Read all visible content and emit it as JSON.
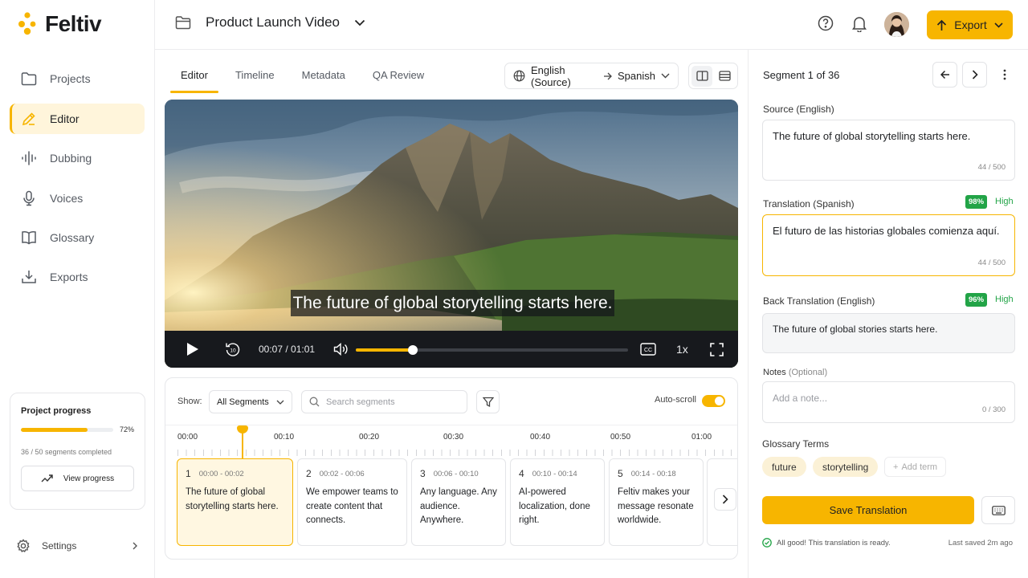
{
  "app": {
    "name": "Feltiv"
  },
  "sidebar": {
    "items": [
      {
        "label": "Projects",
        "icon": "folder-icon",
        "active": false
      },
      {
        "label": "Editor",
        "icon": "pencil-icon",
        "active": true
      },
      {
        "label": "Dubbing",
        "icon": "waveform-icon",
        "active": false
      },
      {
        "label": "Voices",
        "icon": "microphone-icon",
        "active": false
      },
      {
        "label": "Glossary",
        "icon": "book-icon",
        "active": false
      },
      {
        "label": "Exports",
        "icon": "download-tray-icon",
        "active": false
      }
    ],
    "progress": {
      "title": "Project progress",
      "percent_label": "72%",
      "percent": 72,
      "segments_text": "36 / 50 segments completed",
      "button": "View progress"
    },
    "settings_label": "Settings"
  },
  "header": {
    "project_title": "Product Launch Video",
    "export_label": "Export"
  },
  "tabs": [
    {
      "label": "Editor",
      "active": true
    },
    {
      "label": "Timeline",
      "active": false
    },
    {
      "label": "Metadata",
      "active": false
    },
    {
      "label": "QA Review",
      "active": false
    }
  ],
  "language": {
    "source": "English (Source)",
    "target": "Spanish"
  },
  "video": {
    "subtitle": "The future of global storytelling starts here.",
    "time": "00:07 / 01:01",
    "speed": "1x",
    "progress_fraction": 0.21
  },
  "segments_panel": {
    "show_label": "Show:",
    "filter_value": "All Segments",
    "search_placeholder": "Search segments",
    "autoscroll_label": "Auto-scroll",
    "autoscroll_on": true,
    "ruler": [
      "00:00",
      "00:10",
      "00:20",
      "00:30",
      "00:40",
      "00:50",
      "01:00"
    ],
    "cards": [
      {
        "num": "1",
        "time": "00:00 - 00:02",
        "text": "The future of global storytelling starts here.",
        "active": true
      },
      {
        "num": "2",
        "time": "00:02 - 00:06",
        "text": "We empower teams to create content that connects.",
        "active": false
      },
      {
        "num": "3",
        "time": "00:06 - 00:10",
        "text": "Any language. Any audience. Anywhere.",
        "active": false
      },
      {
        "num": "4",
        "time": "00:10 - 00:14",
        "text": "AI-powered localization, done right.",
        "active": false
      },
      {
        "num": "5",
        "time": "00:14 - 00:18",
        "text": "Feltiv makes your message resonate worldwide.",
        "active": false
      }
    ]
  },
  "right_panel": {
    "segment_label": "Segment 1 of 36",
    "source": {
      "label": "Source (English)",
      "text": "The future of global storytelling starts here.",
      "count": "44 / 500"
    },
    "translation": {
      "label": "Translation (Spanish)",
      "text": "El futuro de las historias globales comienza aquí.",
      "count": "44 / 500",
      "score": "98%",
      "quality": "High"
    },
    "back_translation": {
      "label": "Back Translation (English)",
      "text": "The future of global stories starts here.",
      "score": "96%",
      "quality": "High"
    },
    "notes": {
      "label": "Notes",
      "optional": "(Optional)",
      "placeholder": "Add a note...",
      "count": "0 / 300"
    },
    "glossary": {
      "label": "Glossary Terms",
      "terms": [
        "future",
        "storytelling"
      ],
      "add_label": "Add term"
    },
    "save_label": "Save Translation",
    "status_text": "All good! This translation is ready.",
    "last_saved": "Last saved 2m ago"
  },
  "colors": {
    "accent": "#f7b500",
    "success": "#22a447",
    "accent_soft": "#fff5db"
  }
}
